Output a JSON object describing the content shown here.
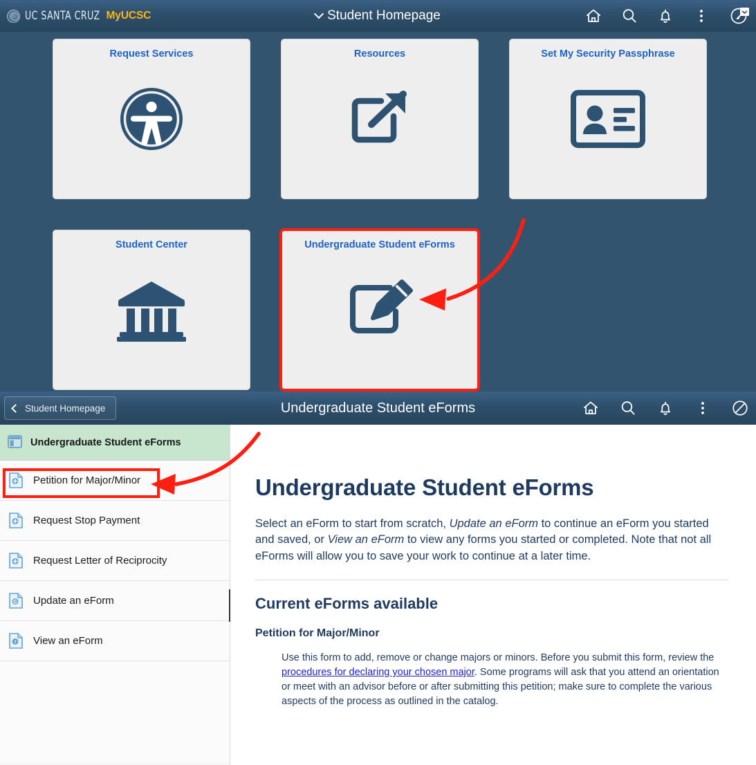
{
  "topbar": {
    "brand_uc": "UC SANTA CRUZ",
    "brand_my": "MyUCSC",
    "title": "Student Homepage",
    "icons": [
      {
        "name": "home-icon",
        "label": "Home"
      },
      {
        "name": "search-icon",
        "label": "Search"
      },
      {
        "name": "notifications-bell-icon",
        "label": "Notifications"
      },
      {
        "name": "kebab-menu-icon",
        "label": "Actions"
      },
      {
        "name": "nav-bar-compass-icon",
        "label": "NavBar"
      }
    ]
  },
  "tiles": {
    "row1": [
      {
        "title": "Request Services",
        "icon": "accessibility-icon"
      },
      {
        "title": "Resources",
        "icon": "external-link-icon"
      },
      {
        "title": "Set My Security Passphrase",
        "icon": "id-card-icon"
      }
    ],
    "row2": [
      {
        "title": "Student Center",
        "icon": "bank-columns-icon"
      },
      {
        "title": "Undergraduate Student eForms",
        "icon": "edit-pencil-square-icon",
        "highlighted": true
      }
    ]
  },
  "subbar": {
    "back_label": "Student Homepage",
    "title": "Undergraduate Student eForms",
    "icons": [
      {
        "name": "home-icon",
        "label": "Home"
      },
      {
        "name": "search-icon",
        "label": "Search"
      },
      {
        "name": "notifications-bell-icon",
        "label": "Notifications"
      },
      {
        "name": "kebab-menu-icon",
        "label": "Actions"
      },
      {
        "name": "nav-bar-slash-circle-icon",
        "label": "NavBar"
      }
    ]
  },
  "sidebar": {
    "header": {
      "label": "Undergraduate Student eForms",
      "icon": "window-panel-icon"
    },
    "items": [
      {
        "label": "Petition for Major/Minor",
        "icon": "document-add-icon",
        "highlighted": true
      },
      {
        "label": "Request Stop Payment",
        "icon": "document-add-icon"
      },
      {
        "label": "Request Letter of Reciprocity",
        "icon": "document-add-icon"
      },
      {
        "label": "Update an eForm",
        "icon": "document-refresh-icon"
      },
      {
        "label": "View an eForm",
        "icon": "document-question-icon"
      }
    ],
    "collapse_handle": "collapse-sidebar-handle"
  },
  "content": {
    "heading": "Undergraduate Student eForms",
    "intro_part1": "Select an eForm to start from scratch, ",
    "intro_em1": "Update an eForm",
    "intro_part2": " to continue an eForm you started and saved, or ",
    "intro_em2": "View an eForm",
    "intro_part3": " to view any forms you started or completed. Note that not all eForms will allow you to save your work to continue at a later time.",
    "section_heading": "Current eForms available",
    "form_name": "Petition for Major/Minor",
    "form_desc_part1": "Use this form to add, remove or change majors or minors. Before you submit this form, review the ",
    "form_desc_link": "procedures for declaring your chosen major",
    "form_desc_part2": ". Some programs will ask that you attend an orientation or meet with an advisor before or after submitting this petition; make sure to complete the various aspects of the process as outlined in the catalog."
  },
  "annotations": {
    "highlight_color": "#ff1f11",
    "arrow_to_tile": "red-arrow-pointing-to-eforms-tile",
    "arrow_to_sidebar_item": "red-arrow-pointing-to-petition-item",
    "box_tile": "red-highlight-box-eforms-tile",
    "box_sidebar_item": "red-highlight-box-petition-item"
  },
  "colors": {
    "nav_bg": "#2d4f6b",
    "page_bg": "#32546f",
    "tile_bg": "#efeeee",
    "tile_title": "#1c64c4",
    "icon_navy": "#2e5372",
    "brand_gold": "#fdb515",
    "sidebar_active_bg": "#c8e6ce",
    "text_navy": "#1f3a5f",
    "link_blue": "#2222cc"
  }
}
